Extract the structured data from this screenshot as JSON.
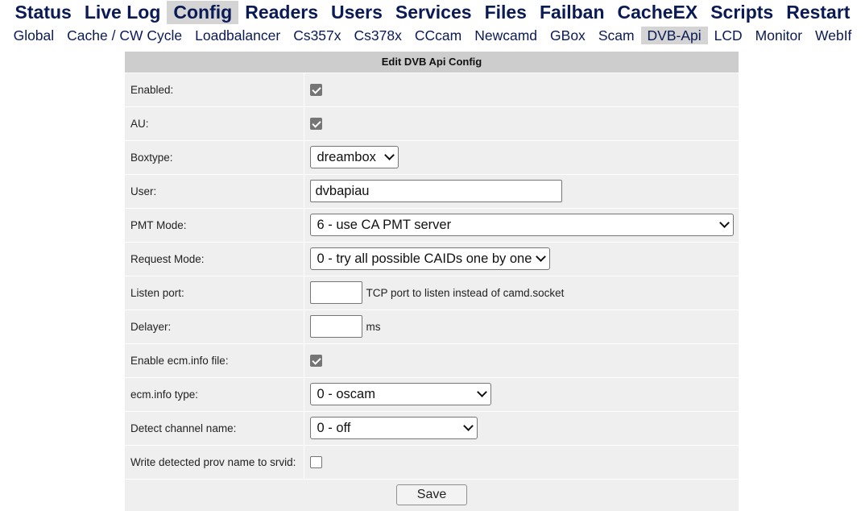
{
  "mainmenu": [
    {
      "label": "Status",
      "active": false
    },
    {
      "label": "Live Log",
      "active": false
    },
    {
      "label": "Config",
      "active": true
    },
    {
      "label": "Readers",
      "active": false
    },
    {
      "label": "Users",
      "active": false
    },
    {
      "label": "Services",
      "active": false
    },
    {
      "label": "Files",
      "active": false
    },
    {
      "label": "Failban",
      "active": false
    },
    {
      "label": "CacheEX",
      "active": false
    },
    {
      "label": "Scripts",
      "active": false
    },
    {
      "label": "Restart",
      "active": false
    }
  ],
  "submenu": [
    {
      "label": "Global",
      "active": false
    },
    {
      "label": "Cache / CW Cycle",
      "active": false
    },
    {
      "label": "Loadbalancer",
      "active": false
    },
    {
      "label": "Cs357x",
      "active": false
    },
    {
      "label": "Cs378x",
      "active": false
    },
    {
      "label": "CCcam",
      "active": false
    },
    {
      "label": "Newcamd",
      "active": false
    },
    {
      "label": "GBox",
      "active": false
    },
    {
      "label": "Scam",
      "active": false
    },
    {
      "label": "DVB-Api",
      "active": true
    },
    {
      "label": "LCD",
      "active": false
    },
    {
      "label": "Monitor",
      "active": false
    },
    {
      "label": "WebIf",
      "active": false
    }
  ],
  "form": {
    "title": "Edit DVB Api Config",
    "enabled": {
      "label": "Enabled:",
      "checked": true
    },
    "au": {
      "label": "AU:",
      "checked": true
    },
    "boxtype": {
      "label": "Boxtype:",
      "value": "dreambox"
    },
    "user": {
      "label": "User:",
      "value": "dvbapiau"
    },
    "pmt_mode": {
      "label": "PMT Mode:",
      "value": "6 - use CA PMT server"
    },
    "request_mode": {
      "label": "Request Mode:",
      "value": "0 - try all possible CAIDs one by one"
    },
    "listen_port": {
      "label": "Listen port:",
      "value": "",
      "hint": "TCP port to listen instead of camd.socket"
    },
    "delayer": {
      "label": "Delayer:",
      "value": "",
      "hint": "ms"
    },
    "ecminfo_file": {
      "label": "Enable ecm.info file:",
      "checked": true
    },
    "ecminfo_type": {
      "label": "ecm.info type:",
      "value": "0 - oscam"
    },
    "detect_channel": {
      "label": "Detect channel name:",
      "value": "0 - off"
    },
    "write_prov": {
      "label": "Write detected prov name to srvid:",
      "checked": false
    },
    "save_label": "Save"
  }
}
